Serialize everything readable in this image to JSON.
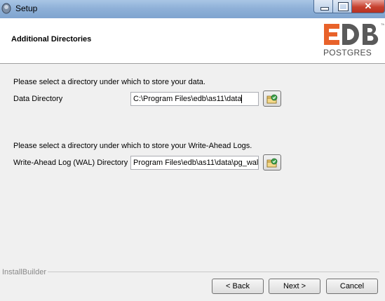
{
  "window": {
    "title": "Setup"
  },
  "header": {
    "page_title": "Additional Directories",
    "logo": {
      "brand_top": "EDB",
      "brand_bottom": "POSTGRES",
      "colors": {
        "e": "#e8622a",
        "d": "#555555",
        "b": "#555555"
      }
    }
  },
  "data_section": {
    "instruction": "Please select a directory under which to store your data.",
    "label": "Data Directory",
    "value": "C:\\Program Files\\edb\\as11\\data"
  },
  "wal_section": {
    "instruction": "Please select a directory under which to store your Write-Ahead Logs.",
    "label": "Write-Ahead Log (WAL) Directory",
    "value": "Program Files\\edb\\as11\\data\\pg_wal"
  },
  "footer": {
    "installer_label": "InstallBuilder",
    "back_label": "< Back",
    "next_label": "Next >",
    "cancel_label": "Cancel"
  },
  "icons": {
    "browse": "folder-browse-icon",
    "app": "setup-app-icon"
  }
}
